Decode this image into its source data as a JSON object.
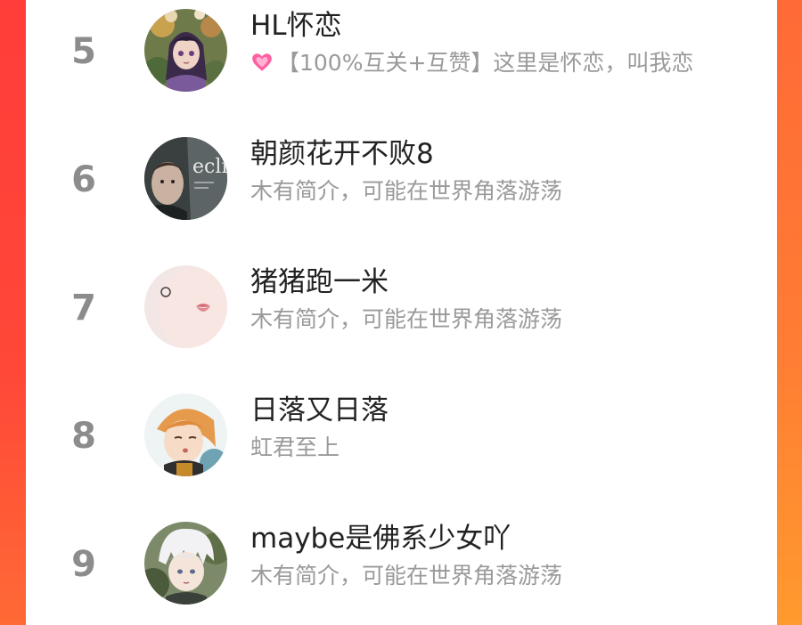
{
  "list": {
    "items": [
      {
        "rank": "5",
        "name": "HL怀恋",
        "bio_icon": "pink-heart-icon",
        "bio": "【100%互关+互赞】这里是怀恋，叫我恋",
        "avatar": "anime-girl-flowers-avatar"
      },
      {
        "rank": "6",
        "name": "朝颜花开不败8",
        "bio": "木有简介，可能在世界角落游荡",
        "avatar": "eclipse-poster-avatar",
        "avatar_text": "eclip"
      },
      {
        "rank": "7",
        "name": "猪猪跑一米",
        "bio": "木有简介，可能在世界角落游荡",
        "avatar": "lips-earring-avatar"
      },
      {
        "rank": "8",
        "name": "日落又日落",
        "bio": "虹君至上",
        "avatar": "orange-hair-anime-avatar"
      },
      {
        "rank": "9",
        "name": "maybe是佛系少女吖",
        "bio": "木有简介，可能在世界角落游荡",
        "avatar": "white-hair-anime-avatar"
      }
    ]
  }
}
